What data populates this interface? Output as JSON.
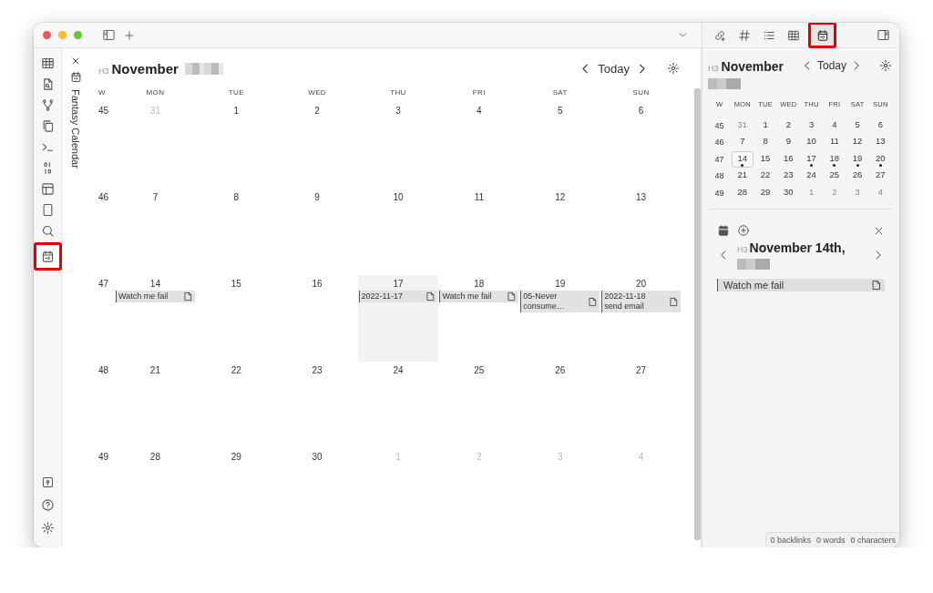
{
  "ribbon": {
    "items": [
      {
        "highlighted": false
      },
      {
        "highlighted": false
      },
      {
        "highlighted": false
      },
      {
        "highlighted": false
      },
      {
        "highlighted": false
      },
      {
        "highlighted": false
      },
      {
        "highlighted": false
      },
      {
        "highlighted": false
      },
      {
        "highlighted": false
      },
      {
        "highlighted": true
      }
    ]
  },
  "view_tab": {
    "label": "Fantasy Calendar"
  },
  "main_calendar": {
    "level_label": "H3",
    "month": "November",
    "year_redacted": true,
    "today_label": "Today",
    "columns": [
      "W",
      "MON",
      "TUE",
      "WED",
      "THU",
      "FRI",
      "SAT",
      "SUN"
    ],
    "weeks": [
      {
        "week": "45",
        "days": [
          {
            "label": "31",
            "outside": true,
            "selected": false
          },
          {
            "label": "1",
            "outside": false,
            "selected": false
          },
          {
            "label": "2",
            "outside": false,
            "selected": false
          },
          {
            "label": "3",
            "outside": false,
            "selected": false
          },
          {
            "label": "4",
            "outside": false,
            "selected": false
          },
          {
            "label": "5",
            "outside": false,
            "selected": false
          },
          {
            "label": "6",
            "outside": false,
            "selected": false
          }
        ]
      },
      {
        "week": "46",
        "days": [
          {
            "label": "7",
            "outside": false,
            "selected": false
          },
          {
            "label": "8",
            "outside": false,
            "selected": false
          },
          {
            "label": "9",
            "outside": false,
            "selected": false
          },
          {
            "label": "10",
            "outside": false,
            "selected": false
          },
          {
            "label": "11",
            "outside": false,
            "selected": false
          },
          {
            "label": "12",
            "outside": false,
            "selected": false
          },
          {
            "label": "13",
            "outside": false,
            "selected": false
          }
        ]
      },
      {
        "week": "47",
        "days": [
          {
            "label": "14",
            "outside": false,
            "selected": false,
            "events": [
              "Watch me fail"
            ]
          },
          {
            "label": "15",
            "outside": false,
            "selected": false
          },
          {
            "label": "16",
            "outside": false,
            "selected": false
          },
          {
            "label": "17",
            "outside": false,
            "selected": true,
            "events": [
              "2022-11-17"
            ]
          },
          {
            "label": "18",
            "outside": false,
            "selected": false,
            "events": [
              "Watch me fail"
            ]
          },
          {
            "label": "19",
            "outside": false,
            "selected": false,
            "events": [
              "05-Never consume…"
            ]
          },
          {
            "label": "20",
            "outside": false,
            "selected": false,
            "events": [
              "2022-11-18 send email"
            ]
          }
        ]
      },
      {
        "week": "48",
        "days": [
          {
            "label": "21",
            "outside": false,
            "selected": false
          },
          {
            "label": "22",
            "outside": false,
            "selected": false
          },
          {
            "label": "23",
            "outside": false,
            "selected": false
          },
          {
            "label": "24",
            "outside": false,
            "selected": false
          },
          {
            "label": "25",
            "outside": false,
            "selected": false
          },
          {
            "label": "26",
            "outside": false,
            "selected": false
          },
          {
            "label": "27",
            "outside": false,
            "selected": false
          }
        ]
      },
      {
        "week": "49",
        "days": [
          {
            "label": "28",
            "outside": false,
            "selected": false
          },
          {
            "label": "29",
            "outside": false,
            "selected": false
          },
          {
            "label": "30",
            "outside": false,
            "selected": false
          },
          {
            "label": "1",
            "outside": true,
            "selected": false
          },
          {
            "label": "2",
            "outside": true,
            "selected": false
          },
          {
            "label": "3",
            "outside": true,
            "selected": false
          },
          {
            "label": "4",
            "outside": true,
            "selected": false
          }
        ]
      }
    ]
  },
  "right_toolbar": {
    "tabs": [
      {
        "selected": false,
        "highlighted": false
      },
      {
        "selected": false,
        "highlighted": false
      },
      {
        "selected": false,
        "highlighted": false
      },
      {
        "selected": false,
        "highlighted": false
      },
      {
        "selected": true,
        "highlighted": true
      }
    ]
  },
  "mini_calendar": {
    "level_label": "H3",
    "month": "November",
    "year_redacted": true,
    "today_label": "Today",
    "columns": [
      "W",
      "MON",
      "TUE",
      "WED",
      "THU",
      "FRI",
      "SAT",
      "SUN"
    ],
    "weeks": [
      {
        "week": "45",
        "days": [
          {
            "label": "31",
            "outside": true,
            "selected": false,
            "dot": false
          },
          {
            "label": "1",
            "outside": false,
            "selected": false,
            "dot": false
          },
          {
            "label": "2",
            "outside": false,
            "selected": false,
            "dot": false
          },
          {
            "label": "3",
            "outside": false,
            "selected": false,
            "dot": false
          },
          {
            "label": "4",
            "outside": false,
            "selected": false,
            "dot": false
          },
          {
            "label": "5",
            "outside": false,
            "selected": false,
            "dot": false
          },
          {
            "label": "6",
            "outside": false,
            "selected": false,
            "dot": false
          }
        ]
      },
      {
        "week": "46",
        "days": [
          {
            "label": "7",
            "outside": false,
            "selected": false,
            "dot": false
          },
          {
            "label": "8",
            "outside": false,
            "selected": false,
            "dot": false
          },
          {
            "label": "9",
            "outside": false,
            "selected": false,
            "dot": false
          },
          {
            "label": "10",
            "outside": false,
            "selected": false,
            "dot": false
          },
          {
            "label": "11",
            "outside": false,
            "selected": false,
            "dot": false
          },
          {
            "label": "12",
            "outside": false,
            "selected": false,
            "dot": false
          },
          {
            "label": "13",
            "outside": false,
            "selected": false,
            "dot": false
          }
        ]
      },
      {
        "week": "47",
        "days": [
          {
            "label": "14",
            "outside": false,
            "selected": true,
            "dot": true
          },
          {
            "label": "15",
            "outside": false,
            "selected": false,
            "dot": false
          },
          {
            "label": "16",
            "outside": false,
            "selected": false,
            "dot": false
          },
          {
            "label": "17",
            "outside": false,
            "selected": false,
            "dot": true
          },
          {
            "label": "18",
            "outside": false,
            "selected": false,
            "dot": true
          },
          {
            "label": "19",
            "outside": false,
            "selected": false,
            "dot": true
          },
          {
            "label": "20",
            "outside": false,
            "selected": false,
            "dot": true
          }
        ]
      },
      {
        "week": "48",
        "days": [
          {
            "label": "21",
            "outside": false,
            "selected": false,
            "dot": false
          },
          {
            "label": "22",
            "outside": false,
            "selected": false,
            "dot": false
          },
          {
            "label": "23",
            "outside": false,
            "selected": false,
            "dot": false
          },
          {
            "label": "24",
            "outside": false,
            "selected": false,
            "dot": false
          },
          {
            "label": "25",
            "outside": false,
            "selected": false,
            "dot": false
          },
          {
            "label": "26",
            "outside": false,
            "selected": false,
            "dot": false
          },
          {
            "label": "27",
            "outside": false,
            "selected": false,
            "dot": false
          }
        ]
      },
      {
        "week": "49",
        "days": [
          {
            "label": "28",
            "outside": false,
            "selected": false,
            "dot": false
          },
          {
            "label": "29",
            "outside": false,
            "selected": false,
            "dot": false
          },
          {
            "label": "30",
            "outside": false,
            "selected": false,
            "dot": false
          },
          {
            "label": "1",
            "outside": true,
            "selected": false,
            "dot": false
          },
          {
            "label": "2",
            "outside": true,
            "selected": false,
            "dot": false
          },
          {
            "label": "3",
            "outside": true,
            "selected": false,
            "dot": false
          },
          {
            "label": "4",
            "outside": true,
            "selected": false,
            "dot": false
          }
        ]
      }
    ]
  },
  "day_panel": {
    "level_label": "H3",
    "title": "November 14th,",
    "year_redacted": true,
    "events": [
      "Watch me fail"
    ]
  },
  "status_bar": [
    "0 backlinks",
    "0 words",
    "0 characters"
  ]
}
